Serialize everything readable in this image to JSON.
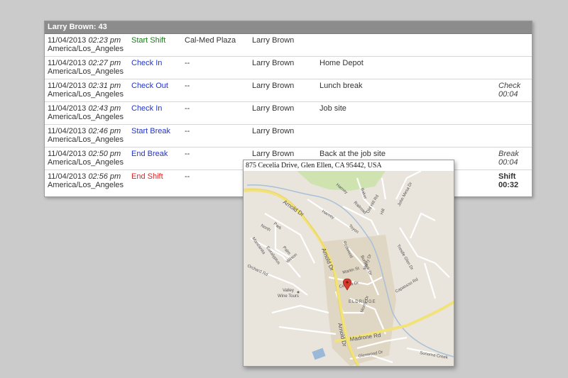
{
  "header": {
    "title": "Larry Brown: 43"
  },
  "rows": [
    {
      "date": "11/04/2013",
      "time": "02:23 pm",
      "tz": "America/Los_Angeles",
      "action": "Start Shift",
      "action_style": "start",
      "location": "Cal-Med Plaza",
      "employee": "Larry Brown",
      "note": "",
      "dur_label": "",
      "dur_value": ""
    },
    {
      "date": "11/04/2013",
      "time": "02:27 pm",
      "tz": "America/Los_Angeles",
      "action": "Check In",
      "action_style": "blue",
      "location": "--",
      "employee": "Larry Brown",
      "note": "Home Depot",
      "dur_label": "",
      "dur_value": ""
    },
    {
      "date": "11/04/2013",
      "time": "02:31 pm",
      "tz": "America/Los_Angeles",
      "action": "Check Out",
      "action_style": "blue",
      "location": "--",
      "employee": "Larry Brown",
      "note": "Lunch break",
      "dur_label": "Check",
      "dur_value": "00:04"
    },
    {
      "date": "11/04/2013",
      "time": "02:43 pm",
      "tz": "America/Los_Angeles",
      "action": "Check In",
      "action_style": "blue",
      "location": "--",
      "employee": "Larry Brown",
      "note": "Job site",
      "dur_label": "",
      "dur_value": ""
    },
    {
      "date": "11/04/2013",
      "time": "02:46 pm",
      "tz": "America/Los_Angeles",
      "action": "Start Break",
      "action_style": "blue",
      "location": "--",
      "employee": "Larry Brown",
      "note": "",
      "dur_label": "",
      "dur_value": ""
    },
    {
      "date": "11/04/2013",
      "time": "02:50 pm",
      "tz": "America/Los_Angeles",
      "action": "End Break",
      "action_style": "blue",
      "location": "--",
      "employee": "Larry Brown",
      "note": "Back at the job site",
      "dur_label": "Break",
      "dur_value": "00:04"
    },
    {
      "date": "11/04/2013",
      "time": "02:56 pm",
      "tz": "America/Los_Angeles",
      "action": "End Shift",
      "action_style": "red",
      "location": "--",
      "employee": "",
      "note": "",
      "dur_label": "Shift",
      "dur_value": "00:32"
    }
  ],
  "map": {
    "address": "875 Cecelia Drive, Glen Ellen, CA 95442, USA",
    "labels": {
      "arnold1": "Arnold Dr",
      "arnold2": "Arnold Dr",
      "harney": "Harney",
      "railroad": "Railroad",
      "baker": "Baker",
      "olddhill": "Old Hill Rd",
      "hill": "Hill",
      "johnmesa": "John Mesa Dr",
      "trestleglen": "Trestle Glen Dr",
      "capassso": "Capassso Rd",
      "north": "North",
      "park": "Park",
      "manzanita": "Manzanita",
      "eucalyptus": "Eucalyptus",
      "palm": "Palm",
      "wilson": "Wilson",
      "orchard": "Orchard Rd",
      "toyon": "Toyon",
      "redwood": "Redwood",
      "burbank": "Burbank Dr",
      "martin": "Martin St",
      "murry": "Murry Dr",
      "cecelia": "Cecelia Dr",
      "eldridge": "ELDRIDGE",
      "valley": "Valley",
      "winetours": "Wine Tours",
      "madrone": "Madrone Rd",
      "glenwood": "Glenwood Dr",
      "sonoma": "Sonoma Creek",
      "morny": "Morny Dr"
    }
  }
}
